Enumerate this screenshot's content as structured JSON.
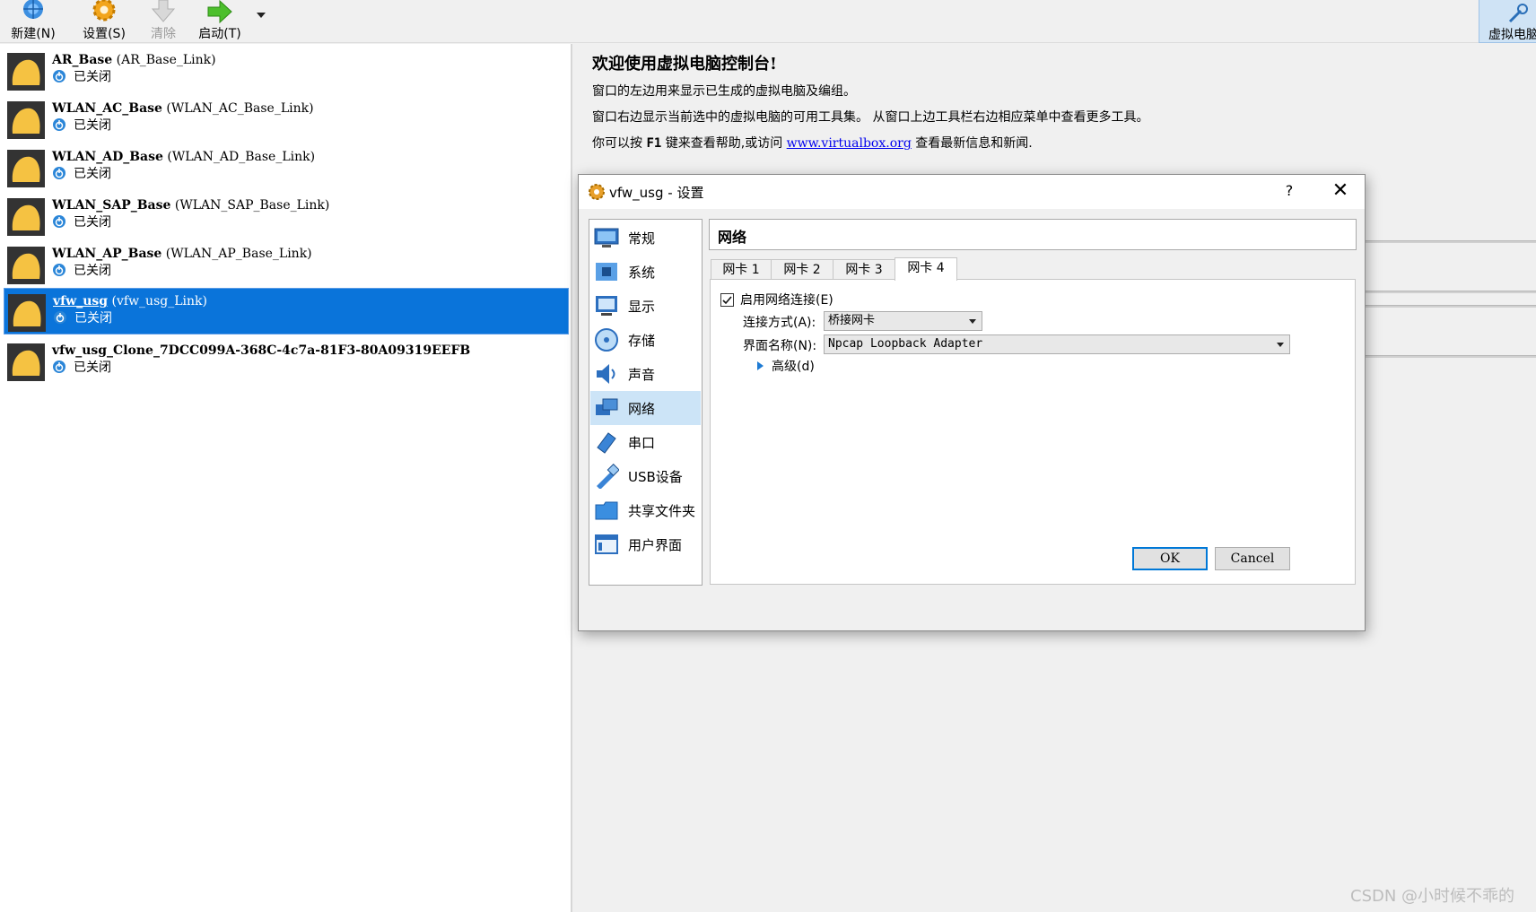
{
  "toolbar": {
    "new_label": "新建(N)",
    "settings_label": "设置(S)",
    "discard_label": "清除",
    "start_label": "启动(T)",
    "right_tool_label": "虚拟电脑"
  },
  "vms": [
    {
      "name": "AR_Base",
      "link": "(AR_Base_Link)",
      "state": "已关闭"
    },
    {
      "name": "WLAN_AC_Base",
      "link": "(WLAN_AC_Base_Link)",
      "state": "已关闭"
    },
    {
      "name": "WLAN_AD_Base",
      "link": "(WLAN_AD_Base_Link)",
      "state": "已关闭"
    },
    {
      "name": "WLAN_SAP_Base",
      "link": "(WLAN_SAP_Base_Link)",
      "state": "已关闭"
    },
    {
      "name": "WLAN_AP_Base",
      "link": "(WLAN_AP_Base_Link)",
      "state": "已关闭"
    },
    {
      "name": "vfw_usg",
      "link": "(vfw_usg_Link)",
      "state": "已关闭"
    },
    {
      "name": "vfw_usg_Clone_7DCC099A-368C-4c7a-81F3-80A09319EEFB",
      "link": "",
      "state": "已关闭"
    }
  ],
  "welcome": {
    "title": "欢迎使用虚拟电脑控制台!",
    "line1": "窗口的左边用来显示已生成的虚拟电脑及编组。",
    "line2": "窗口右边显示当前选中的虚拟电脑的可用工具集。 从窗口上边工具栏右边相应菜单中查看更多工具。",
    "line3_pre": "你可以按",
    "line3_key": "F1",
    "line3_mid": "键来查看帮助,或访问",
    "line3_link": "www.virtualbox.org",
    "line3_post": "查看最新信息和新闻."
  },
  "dialog": {
    "title": "vfw_usg - 设置",
    "help": "?",
    "close": "✕",
    "categories": [
      "常规",
      "系统",
      "显示",
      "存储",
      "声音",
      "网络",
      "串口",
      "USB设备",
      "共享文件夹",
      "用户界面"
    ],
    "selected_category": "网络",
    "page_title": "网络",
    "tabs": [
      "网卡 1",
      "网卡 2",
      "网卡 3",
      "网卡 4"
    ],
    "active_tab": "网卡 4",
    "enable_label": "启用网络连接(E)",
    "enable_checked": true,
    "attach_label": "连接方式(A):",
    "attach_value": "桥接网卡",
    "iface_label": "界面名称(N):",
    "iface_value": "Npcap Loopback Adapter",
    "advanced_label": "高级(d)",
    "ok": "OK",
    "cancel": "Cancel"
  },
  "watermark": "CSDN @小时候不乖的",
  "colors": {
    "selection": "#0a74da",
    "accent": "#0078d7",
    "link": "#0000ee"
  }
}
